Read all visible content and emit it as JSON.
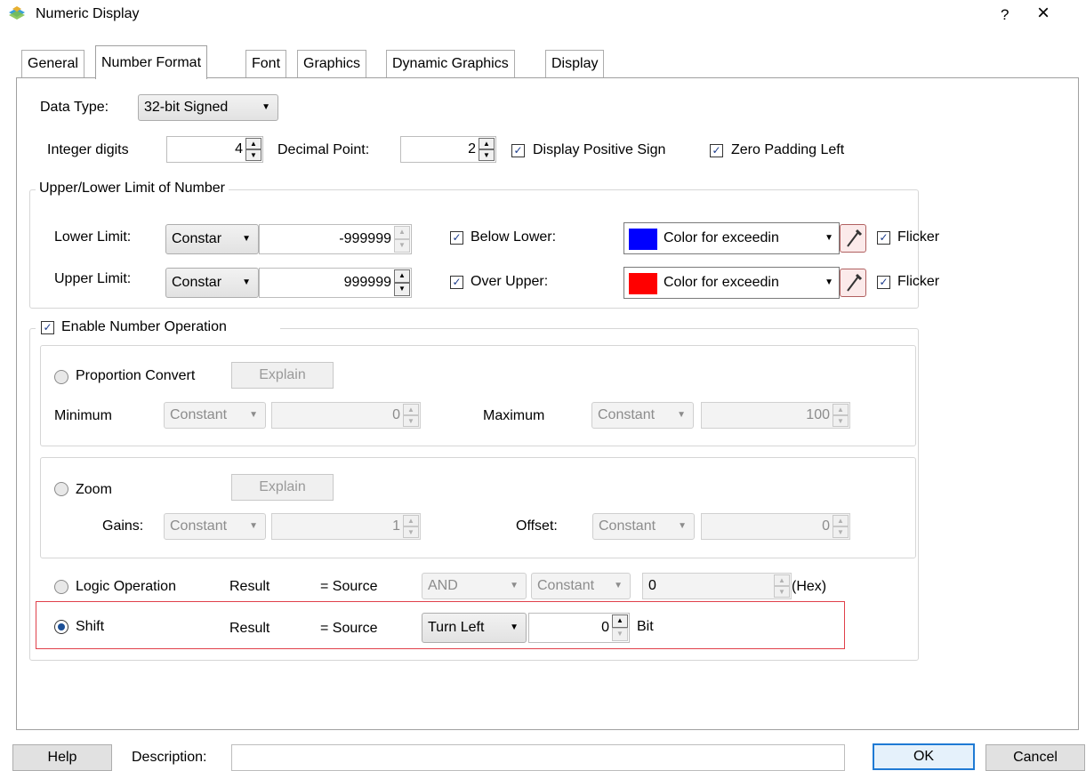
{
  "window": {
    "title": "Numeric Display",
    "help_label": "?",
    "close_label": "×"
  },
  "tabs": [
    {
      "label": "General"
    },
    {
      "label": "Number Format"
    },
    {
      "label": "Font"
    },
    {
      "label": "Graphics"
    },
    {
      "label": "Dynamic Graphics"
    },
    {
      "label": "Display"
    }
  ],
  "active_tab": "Number Format",
  "data_type": {
    "label": "Data Type:",
    "value": "32-bit Signed"
  },
  "integer_digits": {
    "label": "Integer digits",
    "value": "4"
  },
  "decimal_point": {
    "label": "Decimal Point:",
    "value": "2"
  },
  "display_positive_sign": {
    "label": "Display Positive Sign",
    "checked": true
  },
  "zero_padding_left": {
    "label": "Zero Padding Left",
    "checked": true
  },
  "limits": {
    "group_label": "Upper/Lower Limit of Number",
    "lower": {
      "label": "Lower Limit:",
      "source": "Constar",
      "value": "-999999",
      "check_label": "Below Lower:",
      "checked": true,
      "color_label": "Color for exceedin",
      "color": "#0000ff",
      "flicker_label": "Flicker",
      "flicker": true
    },
    "upper": {
      "label": "Upper Limit:",
      "source": "Constar",
      "value": "999999",
      "check_label": "Over Upper:",
      "checked": true,
      "color_label": "Color for exceedin",
      "color": "#ff0000",
      "flicker_label": "Flicker",
      "flicker": true
    }
  },
  "number_operation": {
    "label": "Enable Number Operation",
    "checked": true,
    "proportion": {
      "label": "Proportion Convert",
      "explain": "Explain",
      "min_label": "Minimum",
      "min_source": "Constant",
      "min_value": "0",
      "max_label": "Maximum",
      "max_source": "Constant",
      "max_value": "100"
    },
    "zoom": {
      "label": "Zoom",
      "explain": "Explain",
      "gains_label": "Gains:",
      "gains_source": "Constant",
      "gains_value": "1",
      "offset_label": "Offset:",
      "offset_source": "Constant",
      "offset_value": "0"
    },
    "logic": {
      "label": "Logic Operation",
      "result": "Result",
      "eq_source": "= Source",
      "op": "AND",
      "source": "Constant",
      "value": "0",
      "unit": "(Hex)"
    },
    "shift": {
      "label": "Shift",
      "result": "Result",
      "eq_source": "= Source",
      "direction": "Turn Left",
      "value": "0",
      "unit": "Bit",
      "selected": true
    }
  },
  "footer": {
    "help": "Help",
    "description_label": "Description:",
    "description_value": "",
    "ok": "OK",
    "cancel": "Cancel"
  },
  "colors": {
    "accent": "#1f7ad4",
    "highlight_border": "#e0404a"
  }
}
